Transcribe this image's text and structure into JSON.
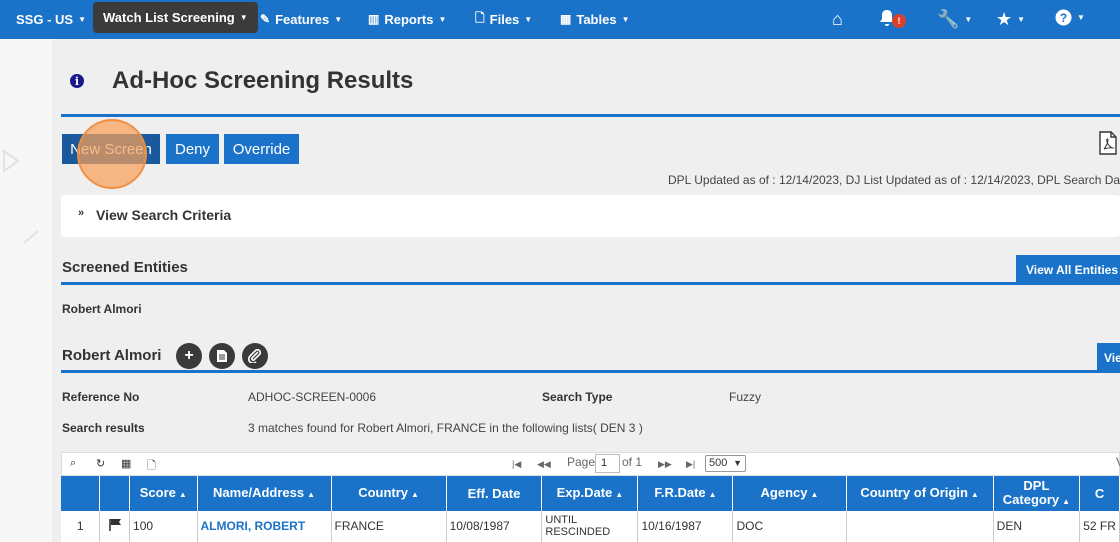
{
  "nav": {
    "org": "SSG - US",
    "items": [
      {
        "label": "Watch List Screening"
      },
      {
        "label": "Features"
      },
      {
        "label": "Reports"
      },
      {
        "label": "Files"
      },
      {
        "label": "Tables"
      }
    ],
    "notification_count": "!"
  },
  "page": {
    "title": "Ad-Hoc Screening Results",
    "buttons": {
      "new_screen": "New Screen",
      "deny": "Deny",
      "override": "Override"
    },
    "dpl_line": "DPL Updated as of : 12/14/2023,  DJ List Updated as of : 12/14/2023,  DPL Search Date",
    "criteria_label": "View Search Criteria"
  },
  "screened_entities": {
    "title": "Screened Entities",
    "view_all_label": "View All Entities I",
    "entity": "Robert Almori"
  },
  "detail": {
    "name": "Robert Almori",
    "view_label": "Vie",
    "reference_label": "Reference No",
    "reference_value": "ADHOC-SCREEN-0006",
    "search_type_label": "Search Type",
    "search_type_value": "Fuzzy",
    "results_label": "Search results",
    "results_value": "3 matches found for  Robert Almori, FRANCE  in the following lists( DEN 3 )"
  },
  "pager": {
    "page_label": "Page",
    "page_value": "1",
    "of_label": "of 1",
    "rows_per_page": "500",
    "right_text": "V"
  },
  "table": {
    "columns": [
      "",
      "",
      "Score",
      "Name/Address",
      "Country",
      "Eff. Date",
      "Exp.Date",
      "F.R.Date",
      "Agency",
      "Country of Origin",
      "DPL Category",
      "C"
    ],
    "rows": [
      {
        "num": "1",
        "score": "100",
        "name": "ALMORI, ROBERT",
        "country": "FRANCE",
        "eff_date": "10/08/1987",
        "exp_date": "UNTIL RESCINDED",
        "fr_date": "10/16/1987",
        "agency": "DOC",
        "origin": "",
        "category": "DEN",
        "c": "52 FR"
      }
    ]
  },
  "colors": {
    "brand_blue": "#1a73c8",
    "nav_active": "#3b3b3b",
    "badge": "#d9412b",
    "click_marker": "#f6a05a"
  }
}
